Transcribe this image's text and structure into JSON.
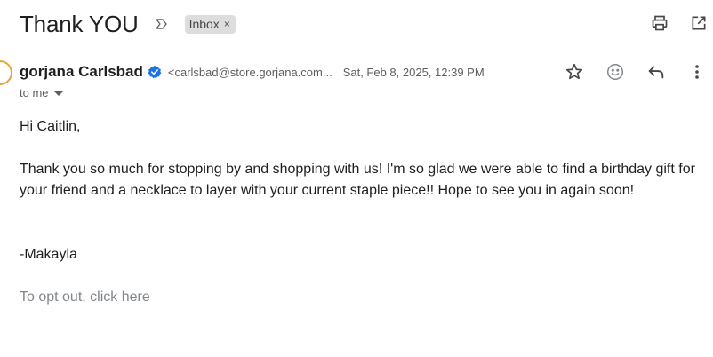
{
  "email": {
    "subject": "Thank YOU",
    "label": "Inbox",
    "label_close": "×",
    "sender_name": "gorjana Carlsbad",
    "sender_email": "<carlsbad@store.gorjana.com...",
    "date": "Sat, Feb 8, 2025, 12:39 PM",
    "recipient": "to me",
    "body": {
      "greeting": "Hi Caitlin,",
      "message": "Thank you so much for stopping by and shopping with us! I'm so glad we were able to find a birthday gift for your friend and a necklace to layer with your current staple piece!! Hope to see you in again soon!",
      "signature": "-Makayla",
      "optout": "To opt out, click here"
    }
  },
  "icons": {
    "important": "important-marker-icon",
    "print": "print-icon",
    "new_window": "open-in-new-window-icon",
    "verified": "verified-check-icon",
    "star": "star-icon",
    "emoji": "emoji-react-icon",
    "reply": "reply-icon",
    "more": "more-vertical-icon",
    "recipient_dropdown": "chevron-down-icon"
  },
  "colors": {
    "verified": "#1a73e8",
    "chip_bg": "#dddddd",
    "muted_text": "#5e5e5e",
    "link_gray": "#80868b"
  }
}
